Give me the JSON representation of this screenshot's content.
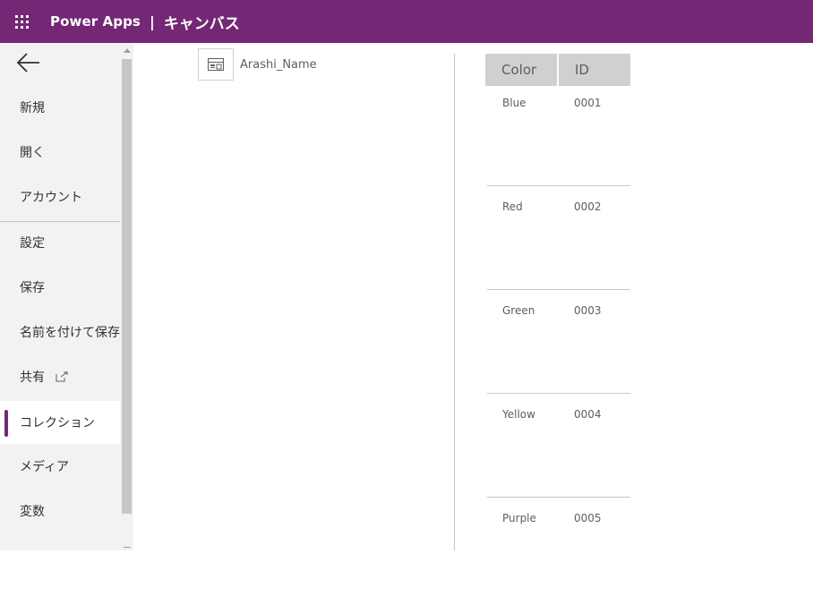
{
  "topbar": {
    "brand": "Power Apps",
    "separator": "|",
    "app_title": "キャンバス"
  },
  "sidebar": {
    "items": [
      {
        "label": "新規"
      },
      {
        "label": "開く"
      },
      {
        "label": "アカウント"
      },
      {
        "label": "設定"
      },
      {
        "label": "保存"
      },
      {
        "label": "名前を付けて保存"
      },
      {
        "label": "共有"
      },
      {
        "label": "コレクション"
      },
      {
        "label": "メディア"
      },
      {
        "label": "変数"
      }
    ],
    "active": "コレクション"
  },
  "collections": {
    "items": [
      {
        "name": "Arashi_Name"
      }
    ]
  },
  "table": {
    "headers": [
      "Color",
      "ID"
    ],
    "rows": [
      {
        "color": "Blue",
        "id": "0001"
      },
      {
        "color": "Red",
        "id": "0002"
      },
      {
        "color": "Green",
        "id": "0003"
      },
      {
        "color": "Yellow",
        "id": "0004"
      },
      {
        "color": "Purple",
        "id": "0005"
      }
    ]
  },
  "colors": {
    "accent": "#742774",
    "sidebar_bg": "#f3f2f1",
    "header_bg": "#d2d0ce"
  },
  "icons": {
    "waffle": "app-launcher-icon",
    "back": "back-arrow-icon",
    "share_external": "external-link-icon",
    "collection": "table-icon"
  }
}
